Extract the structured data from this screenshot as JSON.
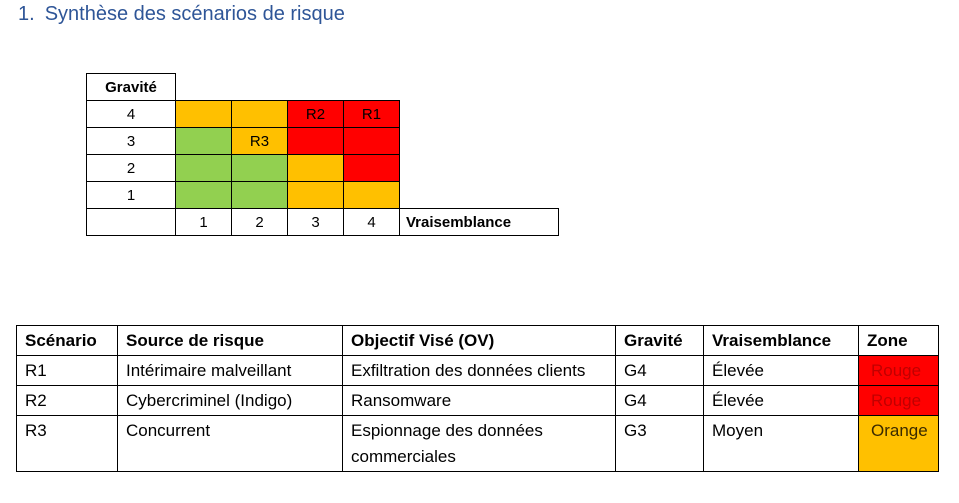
{
  "heading": {
    "number": "1.",
    "title": "Synthèse des scénarios de risque"
  },
  "matrix": {
    "y_label": "Gravité",
    "x_label": "Vraisemblance",
    "rows": [
      {
        "gravite": "4",
        "cells": [
          {
            "color": "#ffc000",
            "label": ""
          },
          {
            "color": "#ffc000",
            "label": ""
          },
          {
            "color": "#ff0000",
            "label": "R2"
          },
          {
            "color": "#ff0000",
            "label": "R1"
          }
        ]
      },
      {
        "gravite": "3",
        "cells": [
          {
            "color": "#92d050",
            "label": ""
          },
          {
            "color": "#ffc000",
            "label": "R3"
          },
          {
            "color": "#ff0000",
            "label": ""
          },
          {
            "color": "#ff0000",
            "label": ""
          }
        ]
      },
      {
        "gravite": "2",
        "cells": [
          {
            "color": "#92d050",
            "label": ""
          },
          {
            "color": "#92d050",
            "label": ""
          },
          {
            "color": "#ffc000",
            "label": ""
          },
          {
            "color": "#ff0000",
            "label": ""
          }
        ]
      },
      {
        "gravite": "1",
        "cells": [
          {
            "color": "#92d050",
            "label": ""
          },
          {
            "color": "#92d050",
            "label": ""
          },
          {
            "color": "#ffc000",
            "label": ""
          },
          {
            "color": "#ffc000",
            "label": ""
          }
        ]
      }
    ],
    "x_values": [
      "1",
      "2",
      "3",
      "4"
    ]
  },
  "scenarios": {
    "headers": [
      "Scénario",
      "Source de risque",
      "Objectif Visé (OV)",
      "Gravité",
      "Vraisemblance",
      "Zone"
    ],
    "rows": [
      {
        "scenario": "R1",
        "source": "Intérimaire malveillant",
        "objectif": "Exfiltration des données clients",
        "gravite": "G4",
        "vraisemblance": "Élevée",
        "zone": "Rouge",
        "zone_color": "#ff0000"
      },
      {
        "scenario": "R2",
        "source": "Cybercriminel (Indigo)",
        "objectif": "Ransomware",
        "gravite": "G4",
        "vraisemblance": "Élevée",
        "zone": "Rouge",
        "zone_color": "#ff0000"
      },
      {
        "scenario": "R3",
        "source": "Concurrent",
        "objectif": "Espionnage des données commerciales",
        "gravite": "G3",
        "vraisemblance": "Moyen",
        "zone": "Orange",
        "zone_color": "#ffc000"
      }
    ]
  }
}
